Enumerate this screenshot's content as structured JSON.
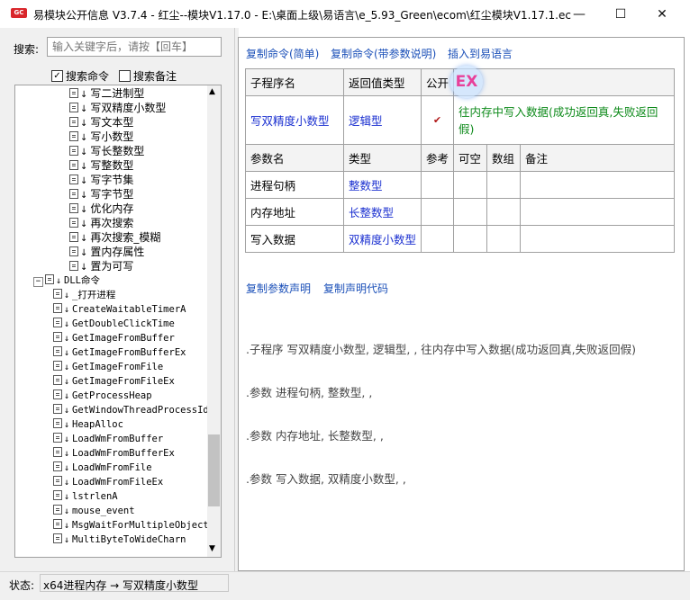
{
  "window": {
    "title": "易模块公开信息 V3.7.4 - 红尘--模块V1.17.0 - E:\\桌面上级\\易语言\\e_5.93_Green\\ecom\\红尘模块V1.17.1.ec",
    "icon_text": "GC",
    "minimize": "—",
    "maximize": "☐",
    "close": "✕"
  },
  "search": {
    "label": "搜索:",
    "placeholder": "输入关键字后，请按【回车】",
    "opt_commands": "搜索命令",
    "opt_commands_checked": true,
    "opt_notes": "搜索备注",
    "opt_notes_checked": false
  },
  "tree": {
    "items": [
      "写二进制型",
      "写双精度小数型",
      "写文本型",
      "写小数型",
      "写长整数型",
      "写整数型",
      "写字节集",
      "写字节型",
      "优化内存",
      "再次搜索",
      "再次搜索_模糊",
      "置内存属性",
      "置为可写"
    ],
    "dll_group": "DLL命令",
    "dll_items": [
      "_打开进程",
      "CreateWaitableTimerA",
      "GetDoubleClickTime",
      "GetImageFromBuffer",
      "GetImageFromBufferEx",
      "GetImageFromFile",
      "GetImageFromFileEx",
      "GetProcessHeap",
      "GetWindowThreadProcessId",
      "HeapAlloc",
      "LoadWmFromBuffer",
      "LoadWmFromBufferEx",
      "LoadWmFromFile",
      "LoadWmFromFileEx",
      "lstrlenA",
      "mouse_event",
      "MsgWaitForMultipleObjects",
      "MultiByteToWideCharn"
    ]
  },
  "actions": {
    "copy_simple": "复制命令(简单)",
    "copy_with_params": "复制命令(带参数说明)",
    "insert_to_e": "插入到易语言"
  },
  "proc_table": {
    "headers": [
      "子程序名",
      "返回值类型",
      "公开"
    ],
    "name": "写双精度小数型",
    "return_type": "逻辑型",
    "public_mark": "✔",
    "description": "往内存中写入数据(成功返回真,失败返回假)",
    "param_headers": [
      "参数名",
      "类型",
      "参考",
      "可空",
      "数组",
      "备注"
    ],
    "params": [
      {
        "name": "进程句柄",
        "type": "整数型"
      },
      {
        "name": "内存地址",
        "type": "长整数型"
      },
      {
        "name": "写入数据",
        "type": "双精度小数型"
      }
    ]
  },
  "decl_actions": {
    "copy_param_decl": "复制参数声明",
    "copy_decl_code": "复制声明代码"
  },
  "code_lines": [
    ".子程序 写双精度小数型, 逻辑型, , 往内存中写入数据(成功返回真,失败返回假)",
    ".参数 进程句柄, 整数型, ,",
    ".参数 内存地址, 长整数型, ,",
    ".参数 写入数据, 双精度小数型, ,"
  ],
  "ex_badge": "EX",
  "status": {
    "label": "状态:",
    "text": "x64进程内存 → 写双精度小数型"
  },
  "colors": {
    "link": "#1a4fb8",
    "type_blue": "#1a2fd0",
    "desc_green": "#0d8a1a",
    "badge_pink": "#e8409a"
  }
}
